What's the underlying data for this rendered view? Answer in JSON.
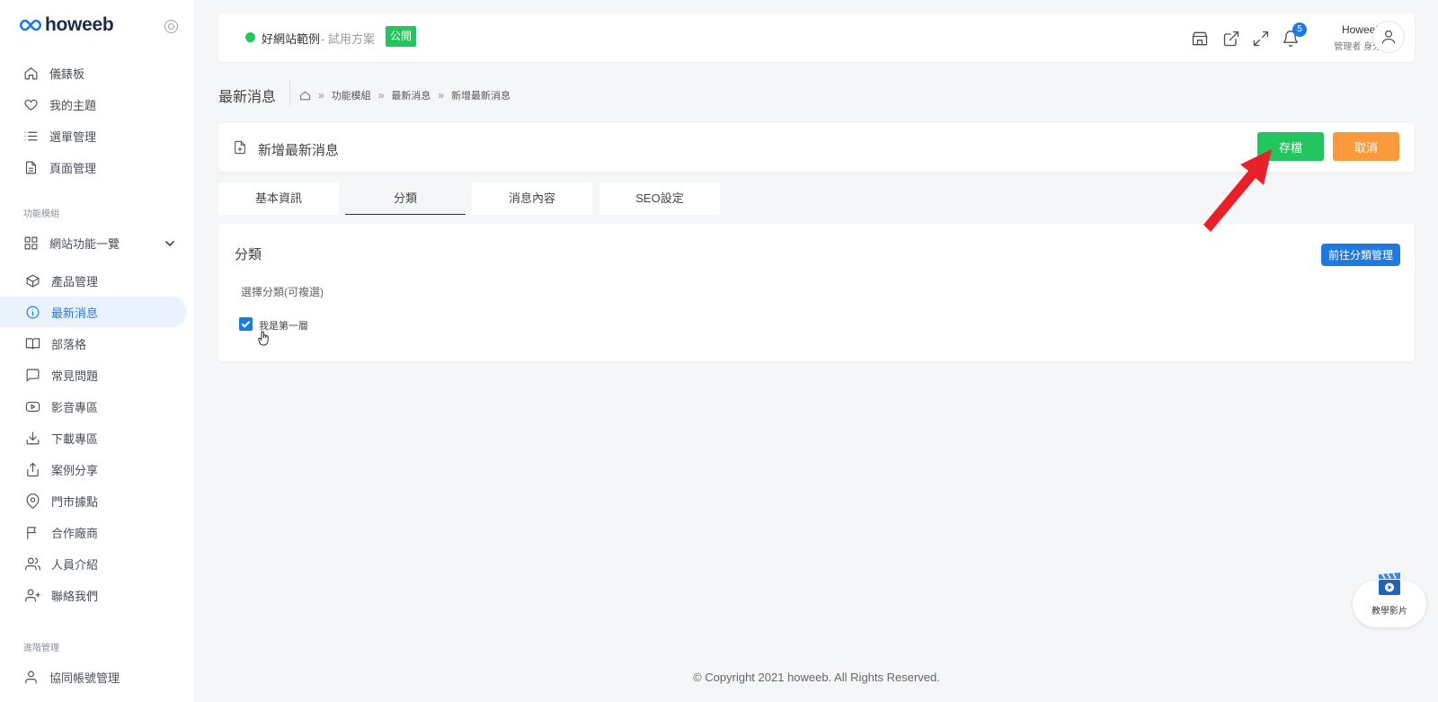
{
  "brand": {
    "name": "howeeb"
  },
  "sidebar": {
    "items_top": [
      {
        "label": "儀錶板",
        "icon": "home-icon"
      },
      {
        "label": "我的主題",
        "icon": "heart-icon"
      },
      {
        "label": "選單管理",
        "icon": "list-icon"
      },
      {
        "label": "頁面管理",
        "icon": "document-icon"
      }
    ],
    "section_modules": "功能模組",
    "group_label": "網站功能一覽",
    "modules": [
      {
        "label": "產品管理",
        "icon": "box-icon"
      },
      {
        "label": "最新消息",
        "icon": "info-icon"
      },
      {
        "label": "部落格",
        "icon": "book-icon"
      },
      {
        "label": "常見問題",
        "icon": "chat-icon"
      },
      {
        "label": "影音專區",
        "icon": "youtube-icon"
      },
      {
        "label": "下載專區",
        "icon": "download-icon"
      },
      {
        "label": "案例分享",
        "icon": "share-icon"
      },
      {
        "label": "門市據點",
        "icon": "map-pin-icon"
      },
      {
        "label": "合作廠商",
        "icon": "flag-icon"
      },
      {
        "label": "人員介紹",
        "icon": "users-icon"
      },
      {
        "label": "聯絡我們",
        "icon": "user-plus-icon"
      }
    ],
    "section_advanced": "進階管理",
    "items_bottom": [
      {
        "label": "協同帳號管理",
        "icon": "user-icon"
      }
    ]
  },
  "topbar": {
    "site_name": "好網站範例",
    "site_plan": " - 試用方案",
    "public_badge": "公開",
    "notification_count": "5",
    "user_name": "Howeeb",
    "user_role": "管理者 身分"
  },
  "breadcrumb": {
    "page_title": "最新消息",
    "items": [
      "功能模組",
      "最新消息",
      "新增最新消息"
    ],
    "separator": "»"
  },
  "header": {
    "title": "新增最新消息",
    "save_label": "存檔",
    "cancel_label": "取消"
  },
  "tabs": [
    {
      "label": "基本資訊"
    },
    {
      "label": "分類"
    },
    {
      "label": "消息內容"
    },
    {
      "label": "SEO設定"
    }
  ],
  "category": {
    "title": "分類",
    "goto_button": "前往分類管理",
    "select_label": "選擇分類(可複選)",
    "options": [
      {
        "label": "我是第一層",
        "checked": true
      }
    ]
  },
  "footer": {
    "copyright": "© Copyright 2021 howeeb. All Rights Reserved."
  },
  "tutorial": {
    "label": "教學影片"
  },
  "colors": {
    "primary": "#1f7ae0",
    "success": "#22c55e",
    "warning": "#fb9a3c",
    "annotation": "#e8202a"
  }
}
